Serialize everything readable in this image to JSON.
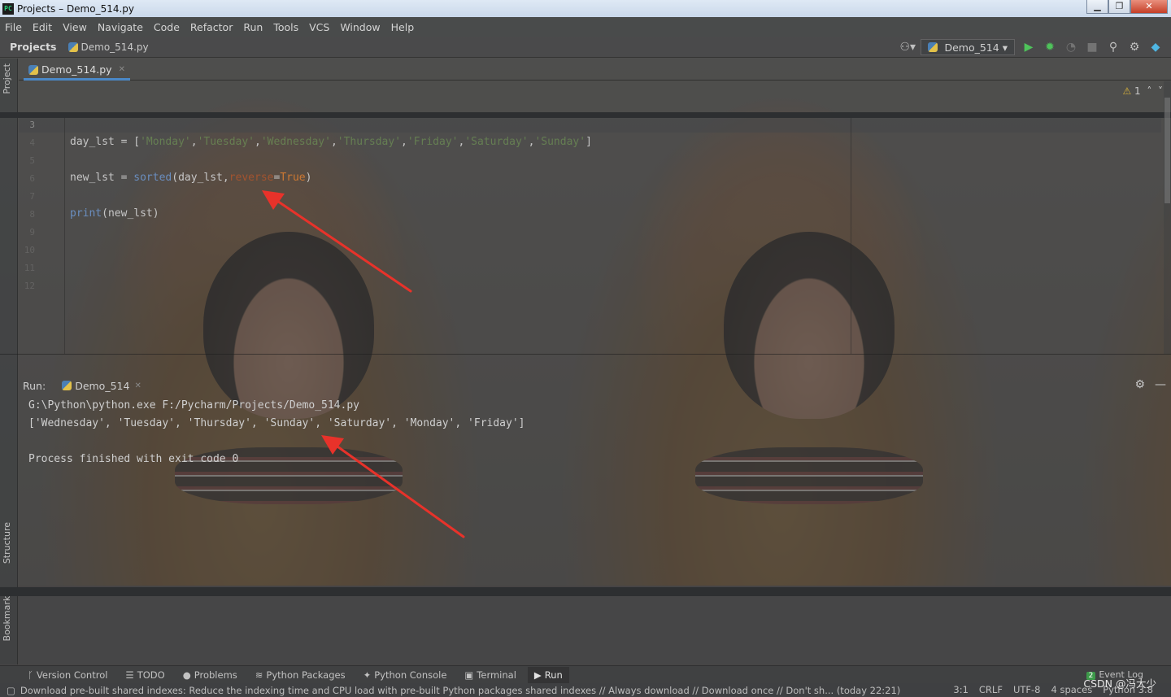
{
  "window": {
    "title": "Projects – Demo_514.py",
    "controls": [
      "▁",
      "❐",
      "✕"
    ]
  },
  "menu": [
    "File",
    "Edit",
    "View",
    "Navigate",
    "Code",
    "Refactor",
    "Run",
    "Tools",
    "VCS",
    "Window",
    "Help"
  ],
  "navbar": {
    "project_label": "Projects",
    "file": "Demo_514.py",
    "run_config": "Demo_514"
  },
  "left_tabs": {
    "project": "Project",
    "structure": "Structure",
    "bookmarks": "Bookmarks"
  },
  "editor": {
    "tab_label": "Demo_514.py",
    "warning_count": "1",
    "line_numbers": [
      "3",
      "4",
      "5",
      "6",
      "7",
      "8",
      "9",
      "10",
      "11",
      "12"
    ],
    "lines": [
      {
        "var": "day_lst",
        "op": " = [",
        "strings": [
          "'Monday'",
          "'Tuesday'",
          "'Wednesday'",
          "'Thursday'",
          "'Friday'",
          "'Saturday'",
          "'Sunday'"
        ],
        "end": "]"
      },
      {
        "var": "new_lst",
        "op": " = ",
        "func": "sorted",
        "args": "(day_lst,",
        "kwarg": "reverse",
        "eq": "=",
        "val": "True",
        "end": ")"
      },
      {
        "func": "print",
        "args": "(new_lst)"
      }
    ]
  },
  "run": {
    "label": "Run:",
    "tab": "Demo_514",
    "output": [
      "G:\\Python\\python.exe F:/Pycharm/Projects/Demo_514.py",
      "['Wednesday', 'Tuesday', 'Thursday', 'Sunday', 'Saturday', 'Monday', 'Friday']",
      "",
      "Process finished with exit code 0"
    ]
  },
  "tool_windows": [
    "Version Control",
    "TODO",
    "Problems",
    "Python Packages",
    "Python Console",
    "Terminal",
    "Run"
  ],
  "event_log": {
    "badge": "2",
    "label": "Event Log"
  },
  "status": {
    "message": "Download pre-built shared indexes: Reduce the indexing time and CPU load with pre-built Python packages shared indexes // Always download // Download once // Don't sh... (today 22:21)",
    "position": "3:1",
    "line_sep": "CRLF",
    "encoding": "UTF-8",
    "indent": "4 spaces",
    "interpreter": "Python 3.8"
  },
  "watermark": "CSDN @冯大少",
  "colors": {
    "accent_tab": "#4a88c7",
    "string": "#6d8f55",
    "keyword": "#cc7832",
    "function": "#6a8ec0",
    "arrow": "#e8322a"
  }
}
